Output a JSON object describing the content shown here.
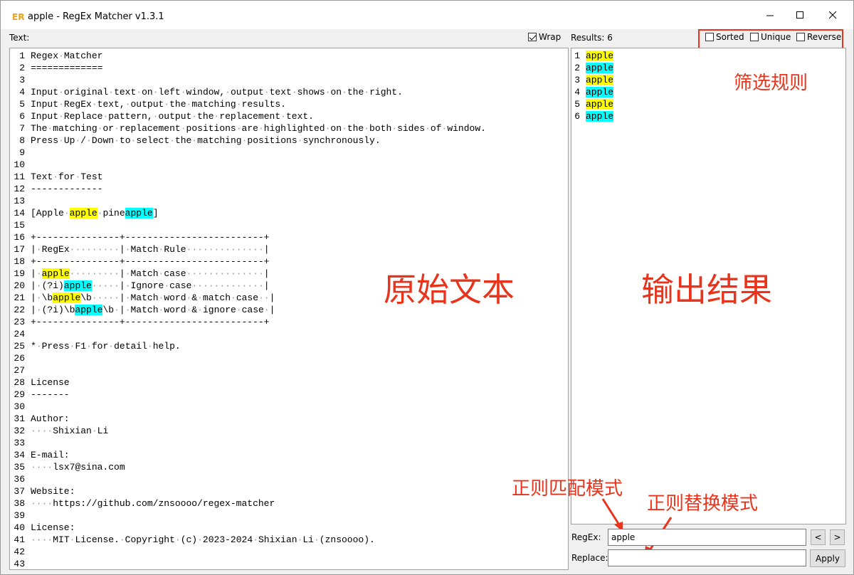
{
  "window": {
    "title": "apple - RegEx Matcher v1.3.1",
    "controls": {
      "minimize": "—",
      "maximize": "☐",
      "close": "✕"
    }
  },
  "left_panel": {
    "label": "Text:",
    "wrap_label": "Wrap",
    "wrap_checked": true,
    "lines": [
      {
        "n": "1",
        "segments": [
          {
            "t": "Regex·Matcher",
            "h": ""
          }
        ]
      },
      {
        "n": "2",
        "segments": [
          {
            "t": "=============",
            "h": ""
          }
        ]
      },
      {
        "n": "3",
        "segments": []
      },
      {
        "n": "4",
        "segments": [
          {
            "t": "Input·original·text·on·left·window,·output·text·shows·on·the·right.",
            "h": ""
          }
        ]
      },
      {
        "n": "5",
        "segments": [
          {
            "t": "Input·RegEx·text,·output·the·matching·results.",
            "h": ""
          }
        ]
      },
      {
        "n": "6",
        "segments": [
          {
            "t": "Input·Replace·pattern,·output·the·replacement·text.",
            "h": ""
          }
        ]
      },
      {
        "n": "7",
        "segments": [
          {
            "t": "The·matching·or·replacement·positions·are·highlighted·on·the·both·sides·of·window.",
            "h": ""
          }
        ]
      },
      {
        "n": "8",
        "segments": [
          {
            "t": "Press·Up·/·Down·to·select·the·matching·positions·synchronously.",
            "h": ""
          }
        ]
      },
      {
        "n": "9",
        "segments": []
      },
      {
        "n": "10",
        "segments": []
      },
      {
        "n": "11",
        "segments": [
          {
            "t": "Text·for·Test",
            "h": ""
          }
        ]
      },
      {
        "n": "12",
        "segments": [
          {
            "t": "-------------",
            "h": ""
          }
        ]
      },
      {
        "n": "13",
        "segments": []
      },
      {
        "n": "14",
        "segments": [
          {
            "t": "[Apple·",
            "h": ""
          },
          {
            "t": "apple",
            "h": "y"
          },
          {
            "t": "·pine",
            "h": ""
          },
          {
            "t": "apple",
            "h": "c"
          },
          {
            "t": "]",
            "h": ""
          }
        ]
      },
      {
        "n": "15",
        "segments": []
      },
      {
        "n": "16",
        "segments": [
          {
            "t": "+---------------+-------------------------+",
            "h": ""
          }
        ]
      },
      {
        "n": "17",
        "segments": [
          {
            "t": "|·RegEx·········|·Match·Rule··············|",
            "h": ""
          }
        ]
      },
      {
        "n": "18",
        "segments": [
          {
            "t": "+---------------+-------------------------+",
            "h": ""
          }
        ]
      },
      {
        "n": "19",
        "segments": [
          {
            "t": "|·",
            "h": ""
          },
          {
            "t": "apple",
            "h": "y"
          },
          {
            "t": "·········|·Match·case··············|",
            "h": ""
          }
        ]
      },
      {
        "n": "20",
        "segments": [
          {
            "t": "|·(?i)",
            "h": ""
          },
          {
            "t": "apple",
            "h": "c"
          },
          {
            "t": "·····|·Ignore·case·············|",
            "h": ""
          }
        ]
      },
      {
        "n": "21",
        "segments": [
          {
            "t": "|·\\b",
            "h": ""
          },
          {
            "t": "apple",
            "h": "y"
          },
          {
            "t": "\\b·····|·Match·word·&·match·case··|",
            "h": ""
          }
        ]
      },
      {
        "n": "22",
        "segments": [
          {
            "t": "|·(?i)\\b",
            "h": ""
          },
          {
            "t": "apple",
            "h": "c"
          },
          {
            "t": "\\b·|·Match·word·&·ignore·case·|",
            "h": ""
          }
        ]
      },
      {
        "n": "23",
        "segments": [
          {
            "t": "+---------------+-------------------------+",
            "h": ""
          }
        ]
      },
      {
        "n": "24",
        "segments": []
      },
      {
        "n": "25",
        "segments": [
          {
            "t": "*·Press·F1·for·detail·help.",
            "h": ""
          }
        ]
      },
      {
        "n": "26",
        "segments": []
      },
      {
        "n": "27",
        "segments": []
      },
      {
        "n": "28",
        "segments": [
          {
            "t": "License",
            "h": ""
          }
        ]
      },
      {
        "n": "29",
        "segments": [
          {
            "t": "-------",
            "h": ""
          }
        ]
      },
      {
        "n": "30",
        "segments": []
      },
      {
        "n": "31",
        "segments": [
          {
            "t": "Author:",
            "h": ""
          }
        ]
      },
      {
        "n": "32",
        "segments": [
          {
            "t": "····Shixian·Li",
            "h": ""
          }
        ]
      },
      {
        "n": "33",
        "segments": []
      },
      {
        "n": "34",
        "segments": [
          {
            "t": "E-mail:",
            "h": ""
          }
        ]
      },
      {
        "n": "35",
        "segments": [
          {
            "t": "····lsx7@sina.com",
            "h": ""
          }
        ]
      },
      {
        "n": "36",
        "segments": []
      },
      {
        "n": "37",
        "segments": [
          {
            "t": "Website:",
            "h": ""
          }
        ]
      },
      {
        "n": "38",
        "segments": [
          {
            "t": "····https://github.com/znsoooo/regex-matcher",
            "h": ""
          }
        ]
      },
      {
        "n": "39",
        "segments": []
      },
      {
        "n": "40",
        "segments": [
          {
            "t": "License:",
            "h": ""
          }
        ]
      },
      {
        "n": "41",
        "segments": [
          {
            "t": "····MIT·License.·Copyright·(c)·2023-2024·Shixian·Li·(znsoooo).",
            "h": ""
          }
        ]
      },
      {
        "n": "42",
        "segments": []
      },
      {
        "n": "43",
        "segments": []
      }
    ]
  },
  "right_panel": {
    "label": "Results: 6",
    "filters": [
      {
        "label": "Sorted",
        "checked": false
      },
      {
        "label": "Unique",
        "checked": false
      },
      {
        "label": "Reverse",
        "checked": false
      }
    ],
    "results": [
      {
        "n": "1",
        "text": "apple",
        "h": "y"
      },
      {
        "n": "2",
        "text": "apple",
        "h": "c"
      },
      {
        "n": "3",
        "text": "apple",
        "h": "y"
      },
      {
        "n": "4",
        "text": "apple",
        "h": "c"
      },
      {
        "n": "5",
        "text": "apple",
        "h": "y"
      },
      {
        "n": "6",
        "text": "apple",
        "h": "c"
      }
    ]
  },
  "bottom": {
    "regex_label": "RegEx:",
    "regex_value": "apple",
    "prev_label": "<",
    "next_label": ">",
    "replace_label": "Replace:",
    "replace_value": "",
    "apply_label": "Apply"
  },
  "annotations": {
    "filter_rules": "筛选规则",
    "original_text": "原始文本",
    "output_result": "输出结果",
    "regex_mode": "正则匹配模式",
    "replace_mode": "正则替换模式"
  },
  "colors": {
    "highlight_yellow": "#ffff00",
    "highlight_cyan": "#00ffff",
    "annotation_red": "#e8341c",
    "app_icon_orange": "#e8a21c"
  }
}
